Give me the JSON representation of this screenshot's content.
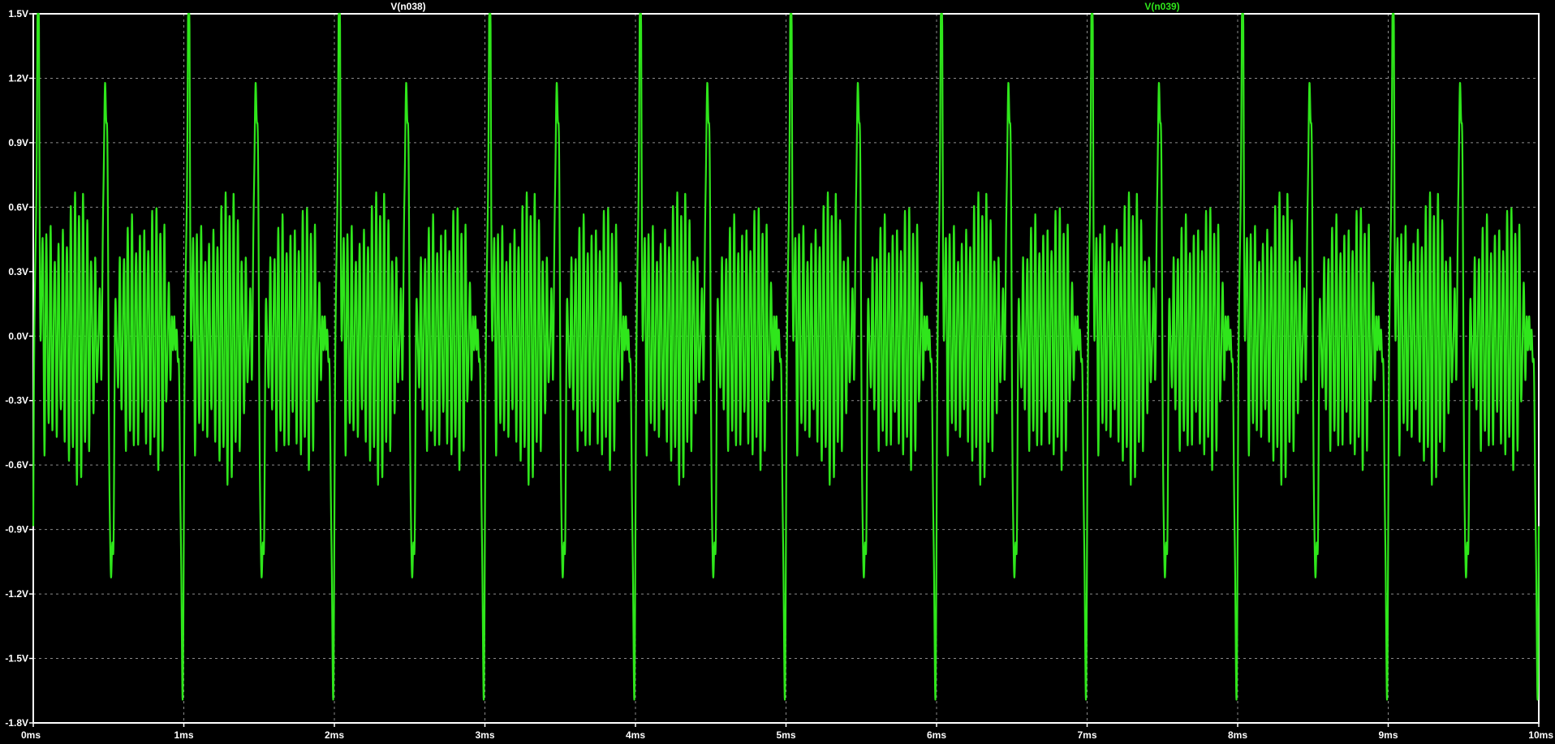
{
  "colors": {
    "background": "#000000",
    "frame": "#ffffff",
    "grid": "#8a8a8a",
    "trace": "#2fe61b",
    "label_default": "#ffffff"
  },
  "chart_data": {
    "type": "line",
    "title": "",
    "xlabel": "",
    "ylabel": "",
    "xlim": [
      0,
      10
    ],
    "ylim": [
      -1.8,
      1.5
    ],
    "grid": true,
    "x_unit": "ms",
    "x_ticks": [
      "0ms",
      "1ms",
      "2ms",
      "3ms",
      "4ms",
      "5ms",
      "6ms",
      "7ms",
      "8ms",
      "9ms",
      "10ms"
    ],
    "y_ticks": [
      "1.5V",
      "1.2V",
      "0.9V",
      "0.6V",
      "0.3V",
      "0.0V",
      "-0.3V",
      "-0.6V",
      "-0.9V",
      "-1.2V",
      "-1.5V",
      "-1.8V"
    ],
    "series": [
      {
        "name": "V(n038)",
        "color": "#ffffff",
        "values": []
      },
      {
        "name": "V(n039)",
        "color": "#2fe61b",
        "fundamental_period_ms": 1.0,
        "peak_max_V": 1.5,
        "secondary_peak_V": 1.27,
        "peak_min_V": -1.5,
        "secondary_trough_V": -1.28
      }
    ]
  }
}
